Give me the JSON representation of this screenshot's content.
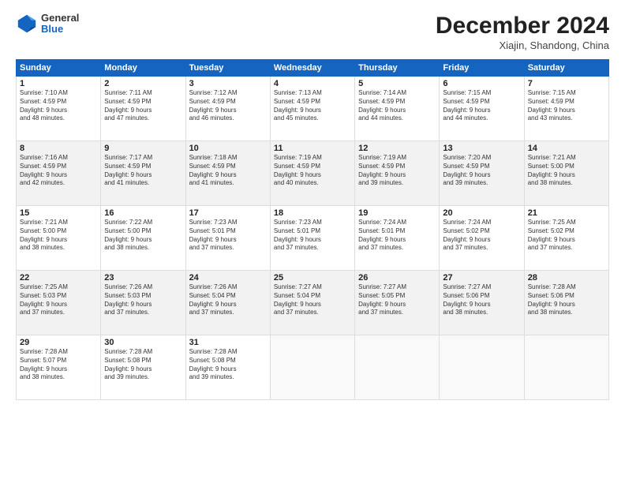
{
  "header": {
    "logo_general": "General",
    "logo_blue": "Blue",
    "month_title": "December 2024",
    "location": "Xiajin, Shandong, China"
  },
  "weekdays": [
    "Sunday",
    "Monday",
    "Tuesday",
    "Wednesday",
    "Thursday",
    "Friday",
    "Saturday"
  ],
  "weeks": [
    [
      {
        "day": "1",
        "info": "Sunrise: 7:10 AM\nSunset: 4:59 PM\nDaylight: 9 hours\nand 48 minutes."
      },
      {
        "day": "2",
        "info": "Sunrise: 7:11 AM\nSunset: 4:59 PM\nDaylight: 9 hours\nand 47 minutes."
      },
      {
        "day": "3",
        "info": "Sunrise: 7:12 AM\nSunset: 4:59 PM\nDaylight: 9 hours\nand 46 minutes."
      },
      {
        "day": "4",
        "info": "Sunrise: 7:13 AM\nSunset: 4:59 PM\nDaylight: 9 hours\nand 45 minutes."
      },
      {
        "day": "5",
        "info": "Sunrise: 7:14 AM\nSunset: 4:59 PM\nDaylight: 9 hours\nand 44 minutes."
      },
      {
        "day": "6",
        "info": "Sunrise: 7:15 AM\nSunset: 4:59 PM\nDaylight: 9 hours\nand 44 minutes."
      },
      {
        "day": "7",
        "info": "Sunrise: 7:15 AM\nSunset: 4:59 PM\nDaylight: 9 hours\nand 43 minutes."
      }
    ],
    [
      {
        "day": "8",
        "info": "Sunrise: 7:16 AM\nSunset: 4:59 PM\nDaylight: 9 hours\nand 42 minutes."
      },
      {
        "day": "9",
        "info": "Sunrise: 7:17 AM\nSunset: 4:59 PM\nDaylight: 9 hours\nand 41 minutes."
      },
      {
        "day": "10",
        "info": "Sunrise: 7:18 AM\nSunset: 4:59 PM\nDaylight: 9 hours\nand 41 minutes."
      },
      {
        "day": "11",
        "info": "Sunrise: 7:19 AM\nSunset: 4:59 PM\nDaylight: 9 hours\nand 40 minutes."
      },
      {
        "day": "12",
        "info": "Sunrise: 7:19 AM\nSunset: 4:59 PM\nDaylight: 9 hours\nand 39 minutes."
      },
      {
        "day": "13",
        "info": "Sunrise: 7:20 AM\nSunset: 4:59 PM\nDaylight: 9 hours\nand 39 minutes."
      },
      {
        "day": "14",
        "info": "Sunrise: 7:21 AM\nSunset: 5:00 PM\nDaylight: 9 hours\nand 38 minutes."
      }
    ],
    [
      {
        "day": "15",
        "info": "Sunrise: 7:21 AM\nSunset: 5:00 PM\nDaylight: 9 hours\nand 38 minutes."
      },
      {
        "day": "16",
        "info": "Sunrise: 7:22 AM\nSunset: 5:00 PM\nDaylight: 9 hours\nand 38 minutes."
      },
      {
        "day": "17",
        "info": "Sunrise: 7:23 AM\nSunset: 5:01 PM\nDaylight: 9 hours\nand 37 minutes."
      },
      {
        "day": "18",
        "info": "Sunrise: 7:23 AM\nSunset: 5:01 PM\nDaylight: 9 hours\nand 37 minutes."
      },
      {
        "day": "19",
        "info": "Sunrise: 7:24 AM\nSunset: 5:01 PM\nDaylight: 9 hours\nand 37 minutes."
      },
      {
        "day": "20",
        "info": "Sunrise: 7:24 AM\nSunset: 5:02 PM\nDaylight: 9 hours\nand 37 minutes."
      },
      {
        "day": "21",
        "info": "Sunrise: 7:25 AM\nSunset: 5:02 PM\nDaylight: 9 hours\nand 37 minutes."
      }
    ],
    [
      {
        "day": "22",
        "info": "Sunrise: 7:25 AM\nSunset: 5:03 PM\nDaylight: 9 hours\nand 37 minutes."
      },
      {
        "day": "23",
        "info": "Sunrise: 7:26 AM\nSunset: 5:03 PM\nDaylight: 9 hours\nand 37 minutes."
      },
      {
        "day": "24",
        "info": "Sunrise: 7:26 AM\nSunset: 5:04 PM\nDaylight: 9 hours\nand 37 minutes."
      },
      {
        "day": "25",
        "info": "Sunrise: 7:27 AM\nSunset: 5:04 PM\nDaylight: 9 hours\nand 37 minutes."
      },
      {
        "day": "26",
        "info": "Sunrise: 7:27 AM\nSunset: 5:05 PM\nDaylight: 9 hours\nand 37 minutes."
      },
      {
        "day": "27",
        "info": "Sunrise: 7:27 AM\nSunset: 5:06 PM\nDaylight: 9 hours\nand 38 minutes."
      },
      {
        "day": "28",
        "info": "Sunrise: 7:28 AM\nSunset: 5:06 PM\nDaylight: 9 hours\nand 38 minutes."
      }
    ],
    [
      {
        "day": "29",
        "info": "Sunrise: 7:28 AM\nSunset: 5:07 PM\nDaylight: 9 hours\nand 38 minutes."
      },
      {
        "day": "30",
        "info": "Sunrise: 7:28 AM\nSunset: 5:08 PM\nDaylight: 9 hours\nand 39 minutes."
      },
      {
        "day": "31",
        "info": "Sunrise: 7:28 AM\nSunset: 5:08 PM\nDaylight: 9 hours\nand 39 minutes."
      },
      null,
      null,
      null,
      null
    ]
  ]
}
